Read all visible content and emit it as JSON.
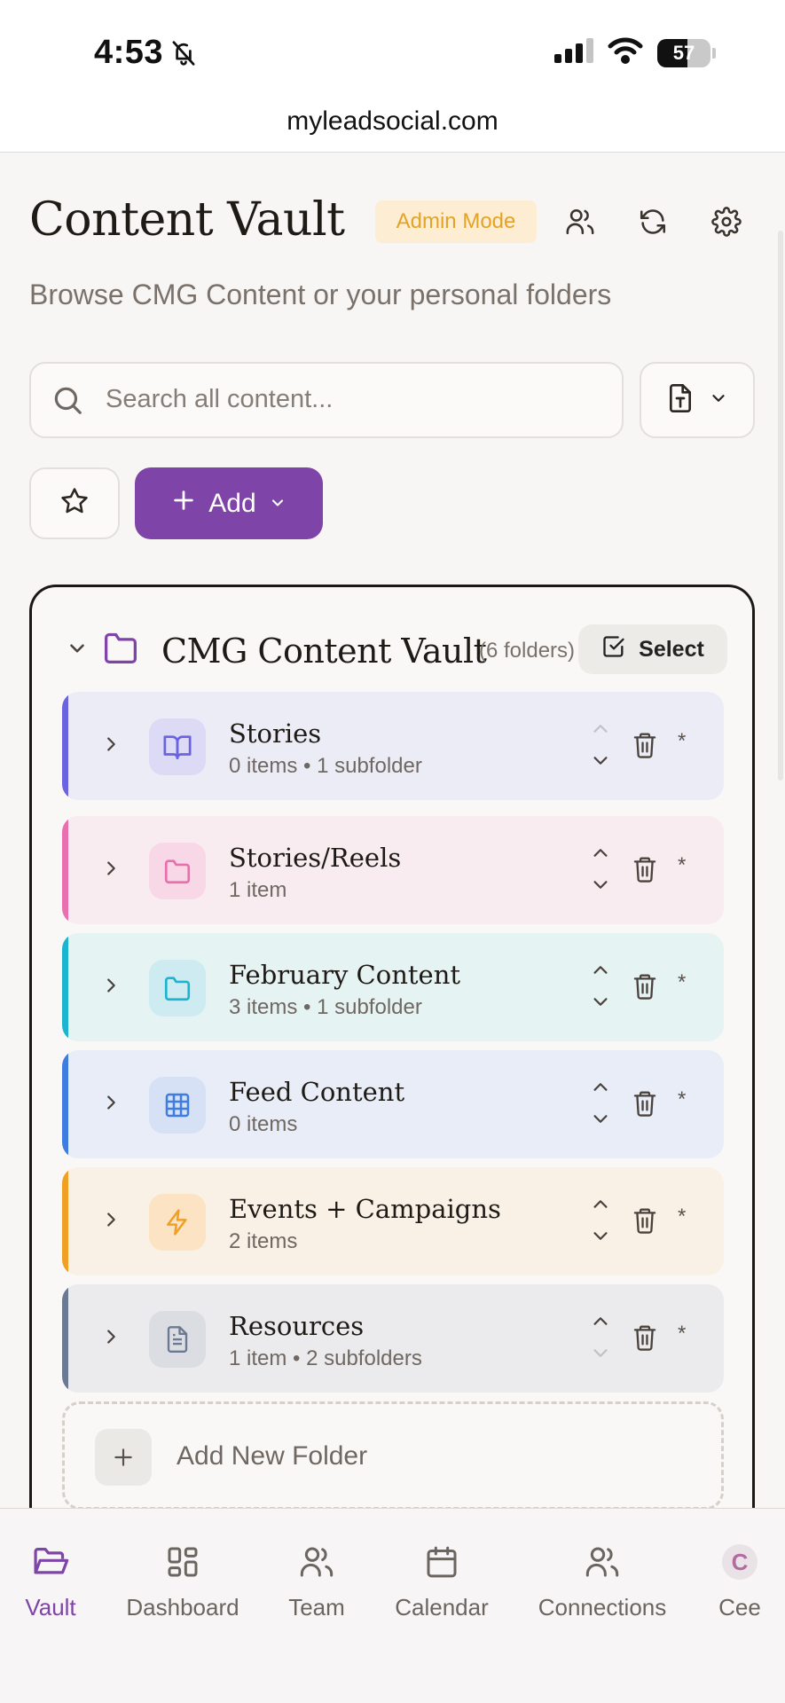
{
  "status": {
    "time": "4:53",
    "battery": "57"
  },
  "browser": {
    "url": "myleadsocial.com"
  },
  "header": {
    "title": "Content Vault",
    "admin_badge": "Admin Mode",
    "subtitle": "Browse CMG Content or your personal folders"
  },
  "search": {
    "placeholder": "Search all content..."
  },
  "toolbar": {
    "add_label": "Add"
  },
  "vault": {
    "title": "CMG Content Vault",
    "count": "(6 folders)",
    "select_label": "Select",
    "folders": [
      {
        "name": "Stories",
        "meta": "0 items • 1 subfolder",
        "icon": "book-open-icon",
        "accent": "#6c63e0",
        "bg": "#ececf7",
        "icon_bg": "#dcdaf5",
        "icon_color": "#6c63e0"
      },
      {
        "name": "Stories/Reels",
        "meta": "1 item",
        "icon": "folder-icon",
        "accent": "#ea6fae",
        "bg": "#f8ecf1",
        "icon_bg": "#f8d7e6",
        "icon_color": "#ea6fae"
      },
      {
        "name": "February Content",
        "meta": "3 items • 1 subfolder",
        "icon": "folder-icon",
        "accent": "#1bb5cf",
        "bg": "#e6f3f3",
        "icon_bg": "#cdebf1",
        "icon_color": "#1bb5cf"
      },
      {
        "name": "Feed Content",
        "meta": "0 items",
        "icon": "grid-icon",
        "accent": "#3f7ee0",
        "bg": "#e9edf7",
        "icon_bg": "#d6e1f6",
        "icon_color": "#3f7ee0"
      },
      {
        "name": "Events + Campaigns",
        "meta": "2 items",
        "icon": "lightning-icon",
        "accent": "#f0a024",
        "bg": "#f9f1e6",
        "icon_bg": "#fbe3c3",
        "icon_color": "#f0a024"
      },
      {
        "name": "Resources",
        "meta": "1 item • 2 subfolders",
        "icon": "document-icon",
        "accent": "#6b7a92",
        "bg": "#ebebed",
        "icon_bg": "#dcdde2",
        "icon_color": "#6b7a92"
      }
    ],
    "add_folder_label": "Add New Folder"
  },
  "nav": {
    "items": [
      {
        "label": "Vault",
        "icon": "folder-open-icon"
      },
      {
        "label": "Dashboard",
        "icon": "dashboard-icon"
      },
      {
        "label": "Team",
        "icon": "users-icon"
      },
      {
        "label": "Calendar",
        "icon": "calendar-icon"
      },
      {
        "label": "Connections",
        "icon": "users-icon"
      },
      {
        "label": "Cee",
        "icon": "avatar",
        "initial": "C"
      }
    ]
  }
}
